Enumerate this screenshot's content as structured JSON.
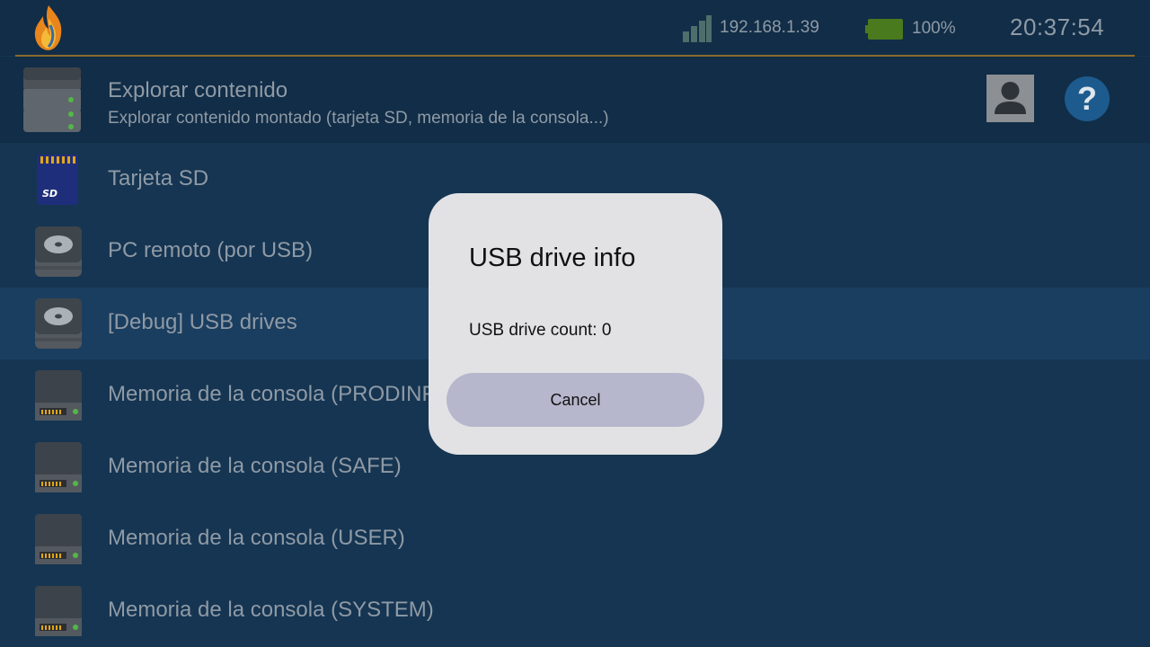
{
  "status": {
    "ip": "192.168.1.39",
    "battery": "100%",
    "battery_level": 1.0,
    "time": "20:37:54",
    "accent_color": "#8a6a2c",
    "battery_color": "#4a7a1e"
  },
  "header": {
    "title": "Explorar contenido",
    "subtitle": "Explorar contenido montado (tarjeta SD, memoria de la consola...)",
    "icon": "storage-stack-icon",
    "help_label": "?"
  },
  "list": {
    "items": [
      {
        "label": "Tarjeta SD",
        "icon": "sd-card-icon"
      },
      {
        "label": "PC remoto (por USB)",
        "icon": "hard-disk-icon"
      },
      {
        "label": "[Debug] USB drives",
        "icon": "hard-disk-icon",
        "selected": true
      },
      {
        "label": "Memoria de la consola (PRODINFOF)",
        "icon": "nand-drive-icon"
      },
      {
        "label": "Memoria de la consola (SAFE)",
        "icon": "nand-drive-icon"
      },
      {
        "label": "Memoria de la consola (USER)",
        "icon": "nand-drive-icon"
      },
      {
        "label": "Memoria de la consola (SYSTEM)",
        "icon": "nand-drive-icon"
      }
    ]
  },
  "dialog": {
    "title": "USB drive info",
    "body": "USB drive count: 0",
    "cancel_label": "Cancel"
  }
}
